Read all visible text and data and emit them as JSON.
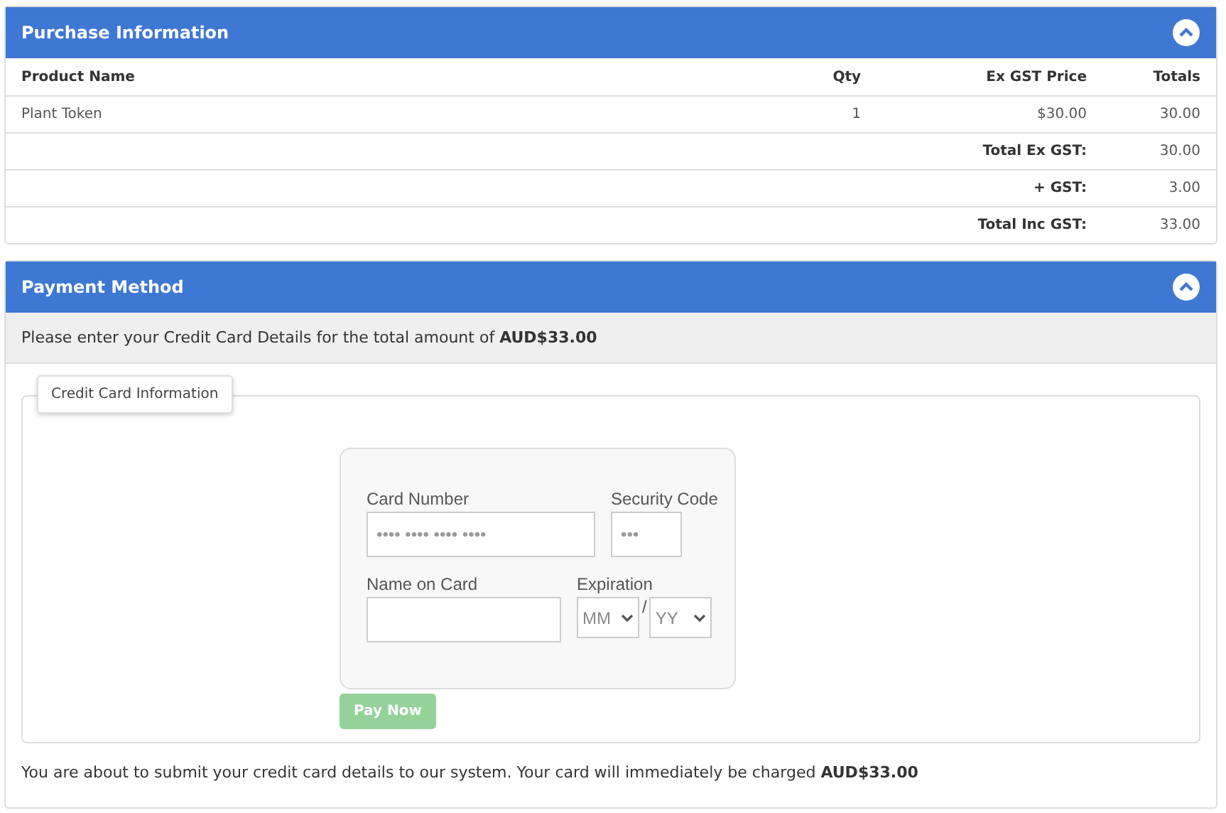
{
  "purchase": {
    "title": "Purchase Information",
    "expanded": true,
    "columns": [
      "Product Name",
      "Qty",
      "Ex GST Price",
      "Totals"
    ],
    "rows": [
      {
        "product": "Plant Token",
        "qty": "1",
        "price": "$30.00",
        "total": "30.00"
      }
    ],
    "summary": [
      {
        "label": "Total Ex GST:",
        "value": "30.00"
      },
      {
        "label": "+ GST:",
        "value": "3.00"
      },
      {
        "label": "Total Inc GST:",
        "value": "33.00"
      }
    ]
  },
  "payment": {
    "title": "Payment Method",
    "expanded": true,
    "notice": "Please enter your Credit Card Details for the total amount of **AUD$33.00**",
    "legend": "Credit Card Information",
    "fields": {
      "card_number": {
        "label": "Card Number",
        "placeholder": "•••• •••• •••• ••••"
      },
      "security_code": {
        "label": "Security Code",
        "placeholder": "•••"
      },
      "name": {
        "label": "Name on Card"
      },
      "expiration": {
        "label": "Expiration",
        "month": "MM",
        "separator": "/",
        "year": "YY"
      }
    },
    "pay_button": {
      "label": "Pay Now",
      "disabled": true
    },
    "footer": "You are about to submit your credit card details to our system. Your card will immediately be charged **AUD$33.00**"
  }
}
